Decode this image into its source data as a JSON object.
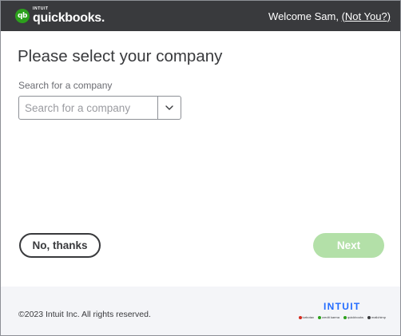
{
  "header": {
    "logo_small": "INTUIT",
    "logo_badge": "qb",
    "logo_word": "quickbooks.",
    "welcome_text": "Welcome Sam, ",
    "not_you_link": "(Not You?)"
  },
  "main": {
    "title": "Please select your company",
    "search_label": "Search for a company",
    "search_placeholder": "Search for a company",
    "search_value": ""
  },
  "buttons": {
    "no_thanks": "No, thanks",
    "next": "Next",
    "next_enabled": false
  },
  "footer": {
    "copyright": "©2023 Intuit Inc. All rights reserved.",
    "intuit_logo": "INTUIT",
    "family": [
      {
        "label": "turbotax",
        "icon": "turbotax-icon",
        "color": "#d52b1e"
      },
      {
        "label": "credit karma",
        "icon": "creditkarma-icon",
        "color": "#2ca01c"
      },
      {
        "label": "quickbooks",
        "icon": "quickbooks-icon",
        "color": "#2ca01c"
      },
      {
        "label": "mailchimp",
        "icon": "mailchimp-icon",
        "color": "#393a3d"
      }
    ]
  },
  "colors": {
    "header_bg": "#393a3d",
    "brand_green": "#2ca01c",
    "next_disabled": "#b3e0a8",
    "intuit_blue": "#236cff",
    "footer_bg": "#f4f5f8"
  }
}
